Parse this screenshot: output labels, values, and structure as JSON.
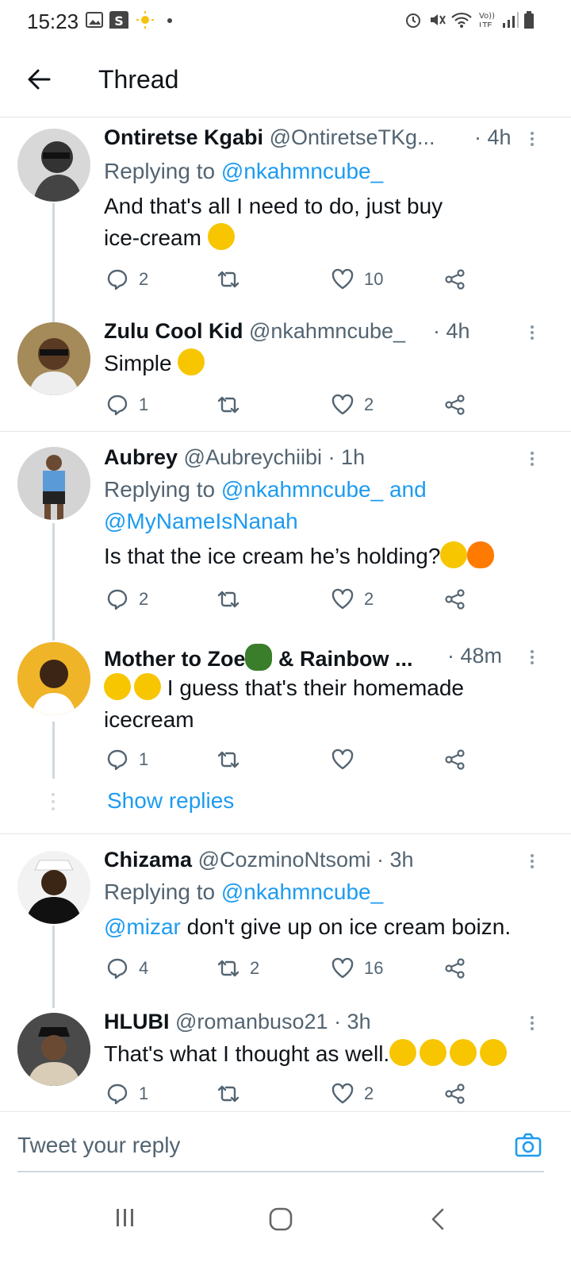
{
  "status": {
    "time": "15:23"
  },
  "header": {
    "title": "Thread"
  },
  "tweets": [
    {
      "name": "Ontiretse Kgabi",
      "handle": "@OntiretseTKg...",
      "time": "· 4h",
      "replying_label": "Replying to",
      "replying_to": "@nkahmncube_",
      "text_1": "And that's all I need to do, just buy",
      "text_2": "ice-cream",
      "replies": "2",
      "retweets": "",
      "likes": "10"
    },
    {
      "name": "Zulu Cool Kid",
      "handle": "@nkahmncube_",
      "time": "· 4h",
      "text_1": "Simple",
      "replies": "1",
      "retweets": "",
      "likes": "2"
    },
    {
      "name": "Aubrey",
      "handle": "@Aubreychiibi",
      "time": "· 1h",
      "replying_label": "Replying to",
      "replying_to": "@nkahmncube_",
      "and_word": "and",
      "replying_to_2": "@MyNameIsNanah",
      "text_1": "Is that the ice cream he’s holding?",
      "replies": "2",
      "retweets": "",
      "likes": "2"
    },
    {
      "name": "Mother to Zoe",
      "name_2": "& Rainbow ...",
      "time": "· 48m",
      "text_1": "I guess that's their homemade",
      "text_2": "icecream",
      "replies": "1",
      "retweets": "",
      "likes": "",
      "show_replies": "Show replies"
    },
    {
      "name": "Chizama",
      "handle": "@CozminoNtsomi",
      "time": "· 3h",
      "replying_label": "Replying to",
      "replying_to": "@nkahmncube_",
      "mention": "@mizar",
      "text_1": "don't give up on ice cream boizn.",
      "replies": "4",
      "retweets": "2",
      "likes": "16"
    },
    {
      "name": "HLUBI",
      "handle": "@romanbuso21",
      "time": "· 3h",
      "text_1": "That's what I thought as well.",
      "replies": "1",
      "retweets": "",
      "likes": "2"
    }
  ],
  "composer": {
    "placeholder": "Tweet your reply"
  },
  "icons": [
    "back-arrow-icon",
    "reply-icon",
    "retweet-icon",
    "like-icon",
    "share-icon",
    "more-icon",
    "camera-icon",
    "recent-apps-icon",
    "home-icon",
    "back-nav-icon"
  ],
  "colors": {
    "accent": "#1d9bf0",
    "secondary_text": "#536471",
    "primary_text": "#0f1419"
  }
}
